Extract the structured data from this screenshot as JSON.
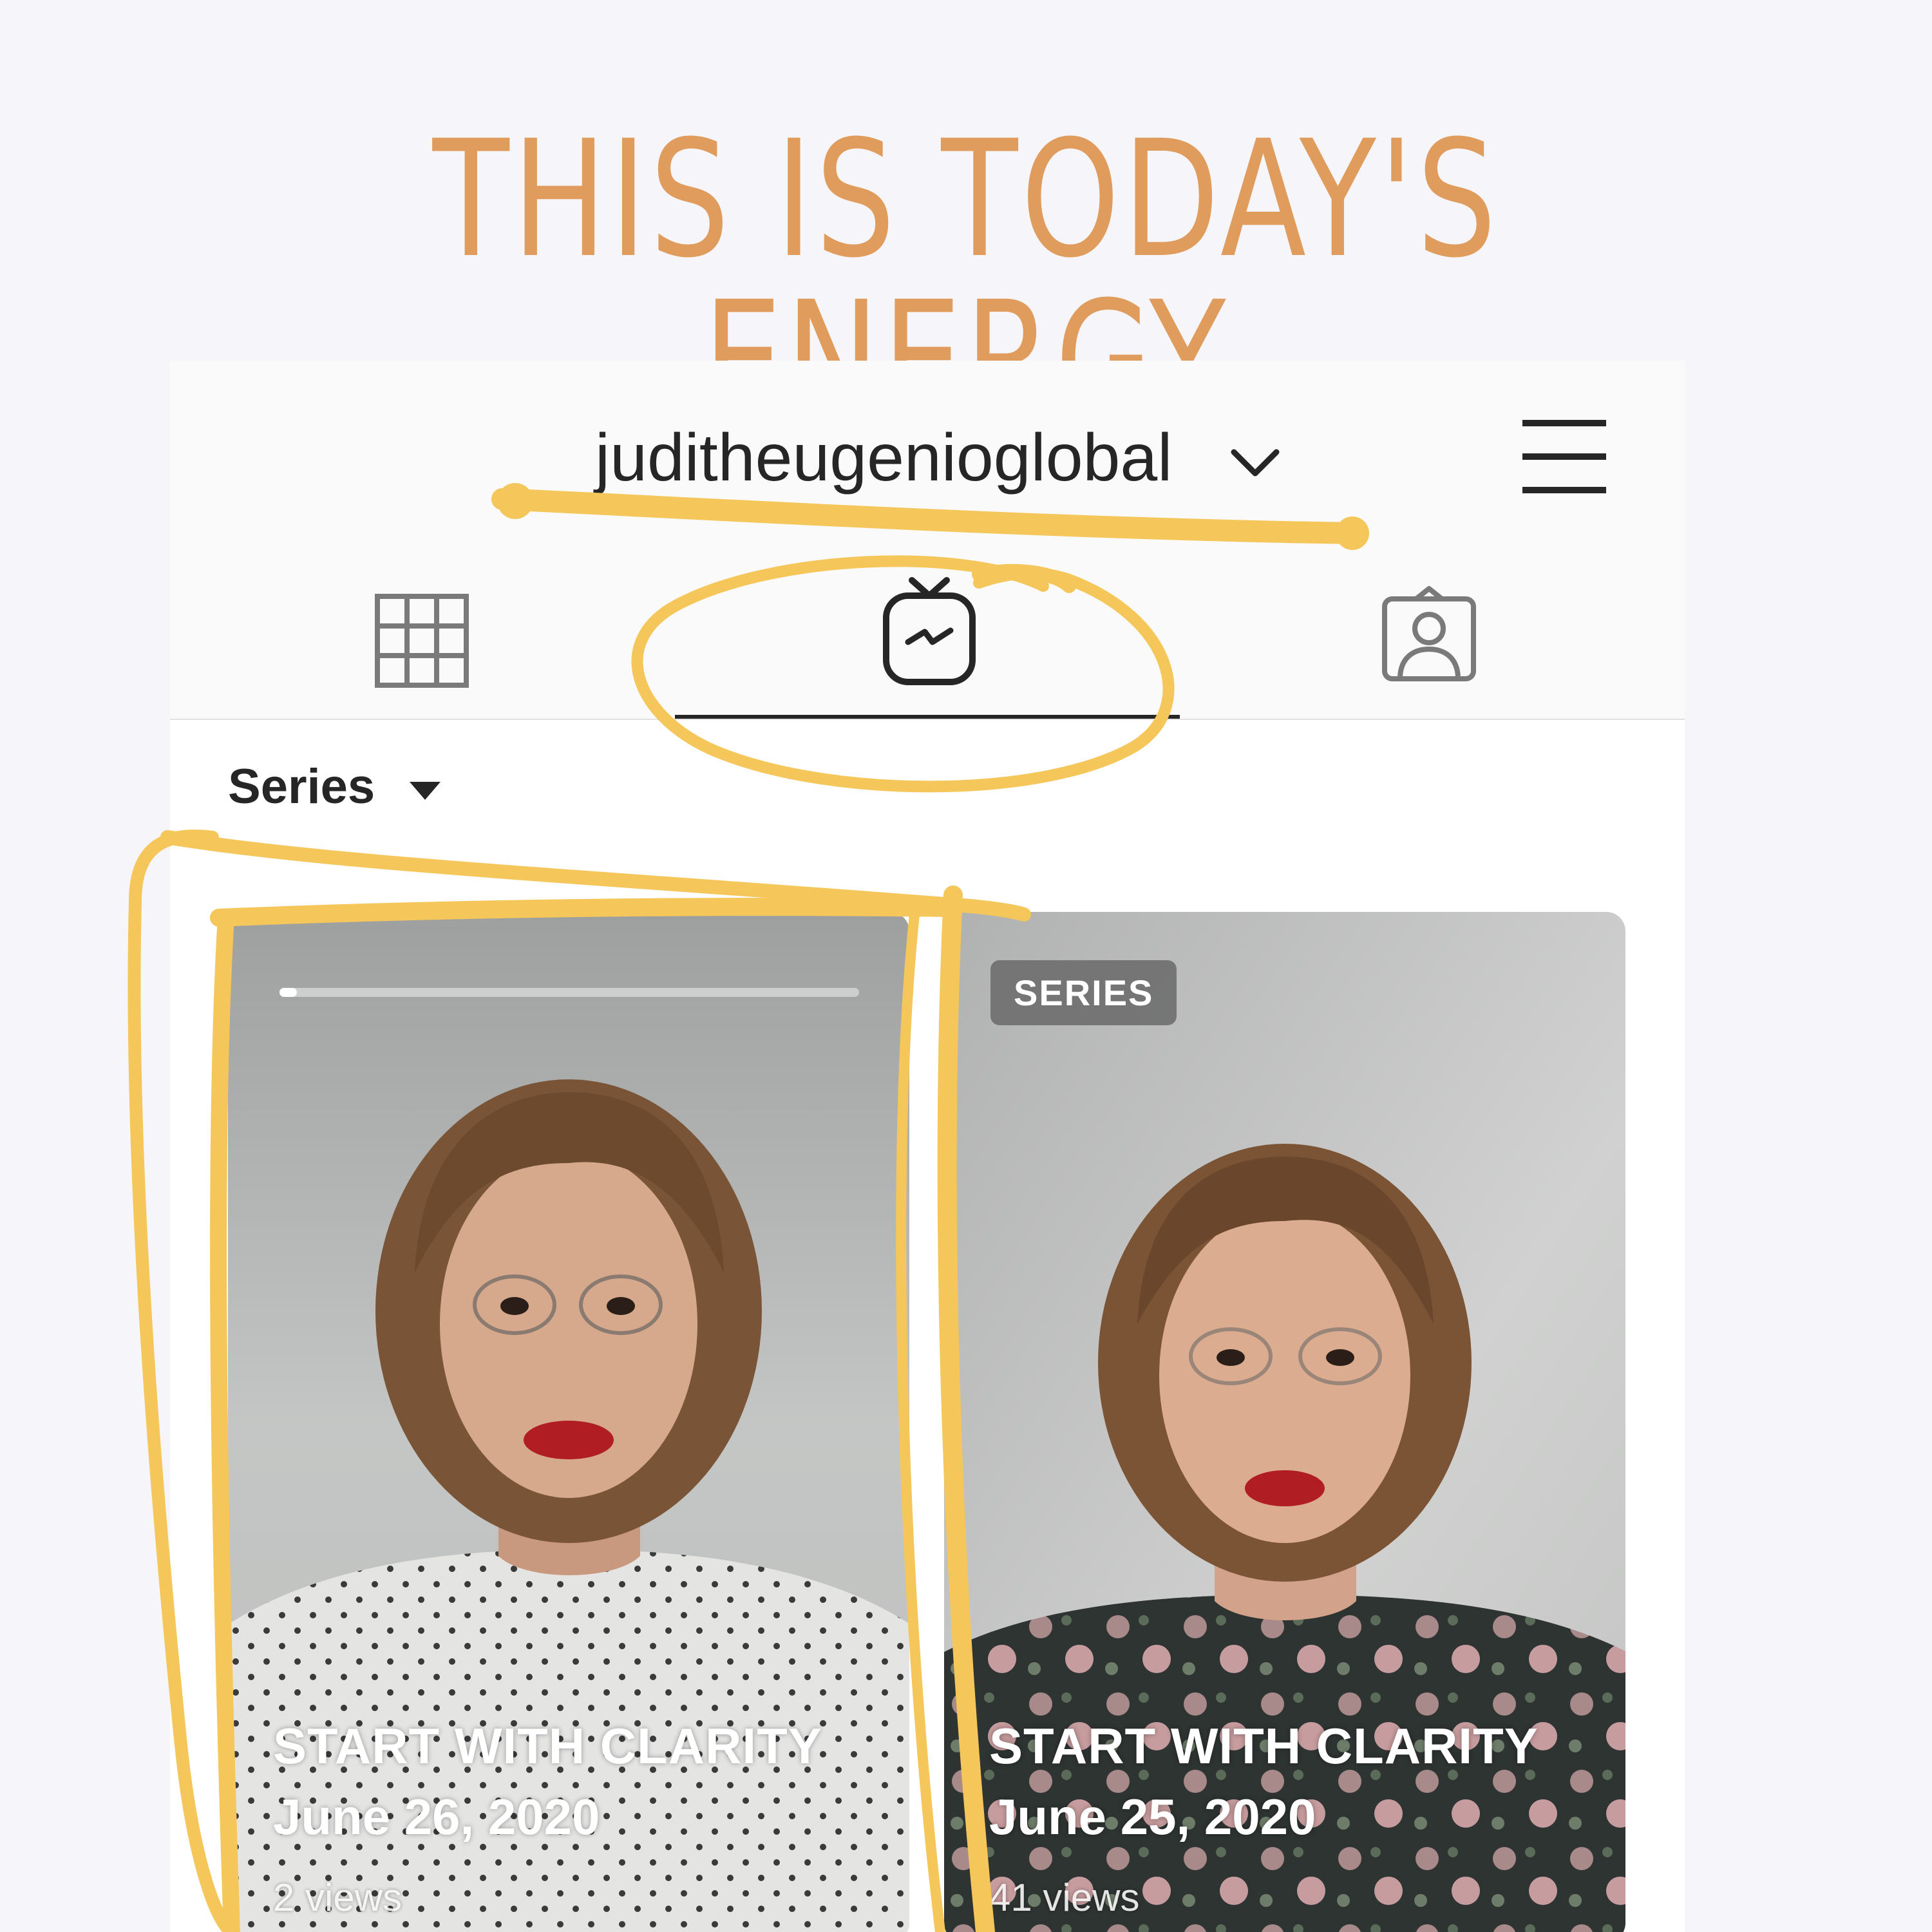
{
  "story": {
    "headline": "THIS IS TODAY'S ENERGY",
    "headline_color": "#e09c5c",
    "annotation_color": "#f5c75a"
  },
  "profile": {
    "username": "juditheugenioglobal",
    "dropdown_icon": "chevron-down-icon",
    "menu_icon": "hamburger-menu-icon"
  },
  "tabs": [
    {
      "name": "posts-grid",
      "icon": "grid-icon",
      "active": false
    },
    {
      "name": "igtv",
      "icon": "igtv-icon",
      "active": true
    },
    {
      "name": "tagged",
      "icon": "tagged-person-icon",
      "active": false
    }
  ],
  "filter": {
    "label": "Series",
    "icon": "caret-down-icon"
  },
  "videos": [
    {
      "title": "START WITH CLARITY",
      "date": "June 26, 2020",
      "views": "2 views",
      "progress": 0.03,
      "badge": null,
      "top_color": "#9ea0a0",
      "shirt": "light-dotted"
    },
    {
      "title": "START WITH CLARITY",
      "date": "June 25, 2020",
      "views": "41 views",
      "progress": null,
      "badge": "SERIES",
      "top_color": "#b7b8b8",
      "shirt": "dark-floral"
    }
  ]
}
